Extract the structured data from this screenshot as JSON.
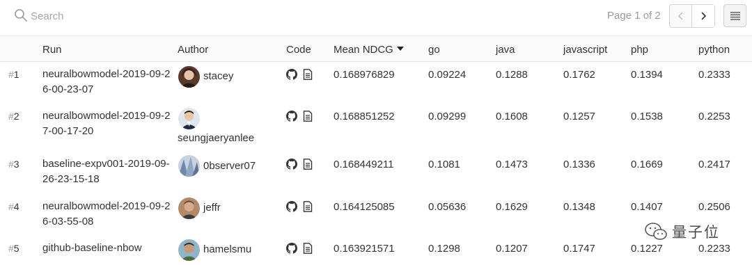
{
  "search": {
    "placeholder": "Search"
  },
  "pager": {
    "text": "Page 1 of 2"
  },
  "columns": {
    "run": "Run",
    "author": "Author",
    "code": "Code",
    "mean_ndcg": "Mean NDCG",
    "go": "go",
    "java": "java",
    "javascript": "javascript",
    "php": "php",
    "python": "python"
  },
  "rows": [
    {
      "rank_hash": "#",
      "rank_num": "1",
      "run": "neuralbowmodel-2019-09-26-00-23-07",
      "author": "stacey",
      "mean_ndcg": "0.168976829",
      "go": "0.09224",
      "java": "0.1288",
      "javascript": "0.1762",
      "php": "0.1394",
      "python": "0.2333"
    },
    {
      "rank_hash": "#",
      "rank_num": "2",
      "run": "neuralbowmodel-2019-09-27-00-17-20",
      "author": "seungjaeryanlee",
      "mean_ndcg": "0.168851252",
      "go": "0.09299",
      "java": "0.1608",
      "javascript": "0.1257",
      "php": "0.1538",
      "python": "0.2253"
    },
    {
      "rank_hash": "#",
      "rank_num": "3",
      "run": "baseline-expv001-2019-09-26-23-15-18",
      "author": "0bserver07",
      "mean_ndcg": "0.168449211",
      "go": "0.1081",
      "java": "0.1473",
      "javascript": "0.1336",
      "php": "0.1669",
      "python": "0.2417"
    },
    {
      "rank_hash": "#",
      "rank_num": "4",
      "run": "neuralbowmodel-2019-09-26-03-55-08",
      "author": "jeffr",
      "mean_ndcg": "0.164125085",
      "go": "0.05636",
      "java": "0.1629",
      "javascript": "0.1348",
      "php": "0.1407",
      "python": "0.2506"
    },
    {
      "rank_hash": "#",
      "rank_num": "5",
      "run": "github-baseline-nbow",
      "author": "hamelsmu",
      "mean_ndcg": "0.163921571",
      "go": "0.1298",
      "java": "0.1207",
      "javascript": "0.1747",
      "php": "0.1227",
      "python": "0.2233"
    }
  ],
  "watermark": {
    "text": "量子位"
  },
  "colors": {
    "text": "#333333",
    "muted": "#9a9a9a",
    "border": "#e4e4e4"
  }
}
